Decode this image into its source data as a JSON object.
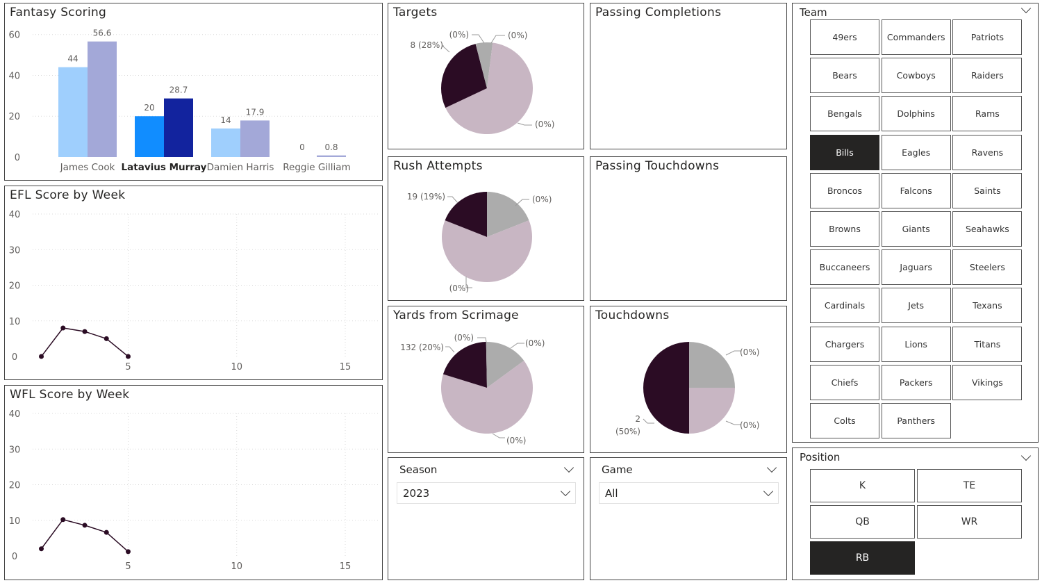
{
  "colors": {
    "pie_dark": "#2b0c24",
    "pie_light": "#c8b6c3",
    "pie_grey": "#acacac",
    "bar_lightblue": "#9fcffd",
    "bar_lavender": "#a3a8d8",
    "bar_blue": "#118dff",
    "bar_navy": "#12239e",
    "line": "#2b0c24",
    "selected_tile": "#252423"
  },
  "fantasy": {
    "title": "Fantasy Scoring",
    "chart_data": {
      "type": "bar",
      "categories": [
        "James Cook",
        "Latavius Murray",
        "Damien Harris",
        "Reggie Gilliam"
      ],
      "highlighted_category": "Latavius Murray",
      "series": [
        {
          "values": [
            44,
            20,
            14,
            0
          ],
          "value_labels": [
            "44",
            "20",
            "14",
            "0"
          ]
        },
        {
          "values": [
            56.6,
            28.7,
            17.9,
            0.8
          ],
          "value_labels": [
            "56.6",
            "28.7",
            "17.9",
            "0.8"
          ]
        }
      ],
      "yticks": [
        "0",
        "20",
        "40",
        "60"
      ],
      "ylim": [
        0,
        65
      ],
      "grid": true
    }
  },
  "efl": {
    "title": "EFL Score by Week",
    "chart_data": {
      "type": "line",
      "x": [
        1,
        2,
        3,
        4,
        5
      ],
      "y": [
        0,
        8,
        7,
        5,
        0
      ],
      "xticks": [
        "5",
        "10",
        "15"
      ],
      "yticks": [
        "0",
        "10",
        "20",
        "30",
        "40"
      ],
      "xlim": [
        0.6,
        16.6
      ],
      "ylim": [
        0,
        40
      ],
      "grid": true
    }
  },
  "wfl": {
    "title": "WFL Score by Week",
    "chart_data": {
      "type": "line",
      "x": [
        1,
        2,
        3,
        4,
        5
      ],
      "y": [
        2,
        10.2,
        8.6,
        6.6,
        1.2
      ],
      "xticks": [
        "5",
        "10",
        "15"
      ],
      "yticks": [
        "0",
        "10",
        "20",
        "30",
        "40"
      ],
      "xlim": [
        0.6,
        16.6
      ],
      "ylim": [
        0,
        40
      ],
      "grid": true
    }
  },
  "pies": {
    "targets": {
      "title": "Targets",
      "chart_data": {
        "type": "pie",
        "slices": [
          {
            "value": 2,
            "color": "grey",
            "label": "(0%)"
          },
          {
            "value": 66,
            "color": "light",
            "label": "(0%)"
          },
          {
            "value": 28,
            "color": "dark",
            "label": "8 (28%)"
          },
          {
            "value": 4,
            "color": "grey",
            "label": "(0%)"
          }
        ]
      }
    },
    "rush": {
      "title": "Rush Attempts",
      "chart_data": {
        "type": "pie",
        "slices": [
          {
            "value": 19,
            "color": "grey",
            "label": "(0%)"
          },
          {
            "value": 62,
            "color": "light",
            "label": "(0%)"
          },
          {
            "value": 19,
            "color": "dark",
            "label": "19 (19%)"
          }
        ]
      }
    },
    "yards": {
      "title": "Yards from Scrimage",
      "chart_data": {
        "type": "pie",
        "slices": [
          {
            "value": 15,
            "color": "grey",
            "label": "(0%)"
          },
          {
            "value": 65,
            "color": "light",
            "label": "(0%)"
          },
          {
            "value": 20,
            "color": "dark",
            "label": "132 (20%)"
          },
          {
            "value": 0.3,
            "color": "grey",
            "label": "(0%)"
          }
        ]
      }
    },
    "touchdowns": {
      "title": "Touchdowns",
      "chart_data": {
        "type": "pie",
        "slices": [
          {
            "value": 25,
            "color": "grey",
            "label": "(0%)"
          },
          {
            "value": 25,
            "color": "light",
            "label": "(0%)"
          },
          {
            "value": 50,
            "color": "dark",
            "label": "2",
            "label2": "(50%)"
          }
        ]
      }
    }
  },
  "passing_completions": {
    "title": "Passing Completions"
  },
  "passing_touchdowns": {
    "title": "Passing Touchdowns"
  },
  "season": {
    "label": "Season",
    "value": "2023"
  },
  "game": {
    "label": "Game",
    "value": "All"
  },
  "team": {
    "label": "Team",
    "selected": "Bills",
    "options": [
      "49ers",
      "Commanders",
      "Patriots",
      "Bears",
      "Cowboys",
      "Raiders",
      "Bengals",
      "Dolphins",
      "Rams",
      "Bills",
      "Eagles",
      "Ravens",
      "Broncos",
      "Falcons",
      "Saints",
      "Browns",
      "Giants",
      "Seahawks",
      "Buccaneers",
      "Jaguars",
      "Steelers",
      "Cardinals",
      "Jets",
      "Texans",
      "Chargers",
      "Lions",
      "Titans",
      "Chiefs",
      "Packers",
      "Vikings",
      "Colts",
      "Panthers"
    ]
  },
  "position": {
    "label": "Position",
    "selected": "RB",
    "options": [
      "K",
      "TE",
      "QB",
      "WR",
      "RB"
    ]
  }
}
